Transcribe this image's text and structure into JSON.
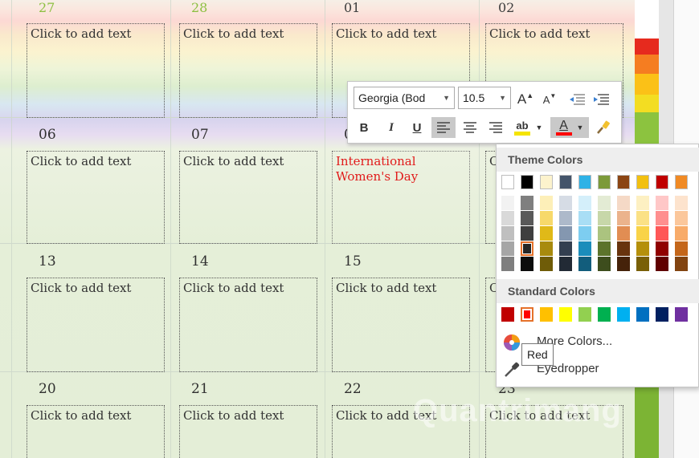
{
  "calendar": {
    "rows": [
      {
        "days": [
          "27",
          "28",
          "01",
          "02"
        ],
        "texts": [
          "Click to add text",
          "Click to add text",
          "Click to add text",
          "Click to add text"
        ]
      },
      {
        "days": [
          "06",
          "07",
          "0",
          ""
        ],
        "texts": [
          "Click to add text",
          "Click to add text",
          "International Women's Day",
          "C"
        ]
      },
      {
        "days": [
          "13",
          "14",
          "15",
          ""
        ],
        "texts": [
          "Click to add text",
          "Click to add text",
          "Click to add text",
          "C"
        ]
      },
      {
        "days": [
          "20",
          "21",
          "22",
          "23"
        ],
        "texts": [
          "Click to add text",
          "Click to add text",
          "Click to add text",
          "Click to add text"
        ]
      }
    ]
  },
  "mini_toolbar": {
    "font_name": "Georgia (Bod",
    "font_size": "10.5",
    "bold": "B",
    "italic": "I",
    "underline": "U",
    "font_color_glyph": "A",
    "grow_font": "A",
    "shrink_font": "A",
    "highlight_glyph": "ab"
  },
  "color_menu": {
    "theme_heading": "Theme Colors",
    "standard_heading": "Standard Colors",
    "more_colors": "More Colors...",
    "eyedropper": "Eyedropper",
    "tooltip": "Red",
    "theme_top": [
      "#ffffff",
      "#000000",
      "#fdf3cd",
      "#44546a",
      "#2fb2e6",
      "#7c9a3a",
      "#8b4513",
      "#f2c010",
      "#c00000",
      "#f08a24"
    ],
    "theme_shades": [
      [
        "#f2f2f2",
        "#d9d9d9",
        "#bfbfbf",
        "#a6a6a6",
        "#7f7f7f"
      ],
      [
        "#7f7f7f",
        "#595959",
        "#3f3f3f",
        "#262626",
        "#0c0c0c"
      ],
      [
        "#fdefb8",
        "#f7d96a",
        "#e0b918",
        "#a88a0d",
        "#6f5c08"
      ],
      [
        "#d6dce5",
        "#adb9ca",
        "#8497b0",
        "#333f50",
        "#222a35"
      ],
      [
        "#d4effa",
        "#a9def5",
        "#7dcdf0",
        "#1b8dbb",
        "#125d7c"
      ],
      [
        "#e3ebd4",
        "#c7d7a9",
        "#abc37f",
        "#5c732b",
        "#3d4d1d"
      ],
      [
        "#f5d9c6",
        "#ebb38c",
        "#e18d53",
        "#68330e",
        "#45220a"
      ],
      [
        "#fdf0c2",
        "#fbe185",
        "#f9d348",
        "#b5900b",
        "#796007"
      ],
      [
        "#ffc7c7",
        "#ff8f8f",
        "#ff5757",
        "#900000",
        "#600000"
      ],
      [
        "#fde3cd",
        "#fbc79b",
        "#f8ab69",
        "#c4661a",
        "#824411"
      ]
    ],
    "theme_selected": {
      "column": 1,
      "row": 3
    },
    "standard": [
      "#c00000",
      "#ff0000",
      "#ffc000",
      "#ffff00",
      "#92d050",
      "#00b050",
      "#00b0f0",
      "#0070c0",
      "#002060",
      "#7030a0"
    ],
    "standard_selected": 1
  },
  "watermark": "Quantrimang"
}
